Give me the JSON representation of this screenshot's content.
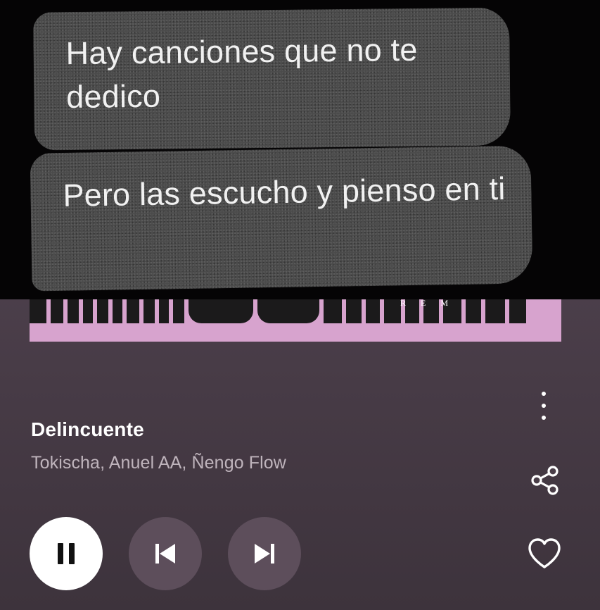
{
  "artwork": {
    "message_1": "Hay canciones que no te dedico",
    "message_2": "Pero las escucho y pienso en ti",
    "banner_tag": "R E M"
  },
  "track": {
    "title": "Delincuente",
    "artists": "Tokischa, Anuel AA, Ñengo Flow"
  },
  "controls": {
    "state": "playing",
    "pause_icon": "pause-icon",
    "previous_icon": "skip-previous-icon",
    "next_icon": "skip-next-icon",
    "share_icon": "share-icon",
    "like_icon": "heart-outline-icon",
    "more_icon": "more-vertical-icon"
  },
  "colors": {
    "background_top": "#5a4a57",
    "background_bottom": "#3d333c",
    "banner_pink": "#d7a3ce",
    "title_text": "#ffffff",
    "subtitle_text": "#bfb4bc",
    "secondary_button": "#5d4e5b",
    "primary_button": "#ffffff"
  }
}
